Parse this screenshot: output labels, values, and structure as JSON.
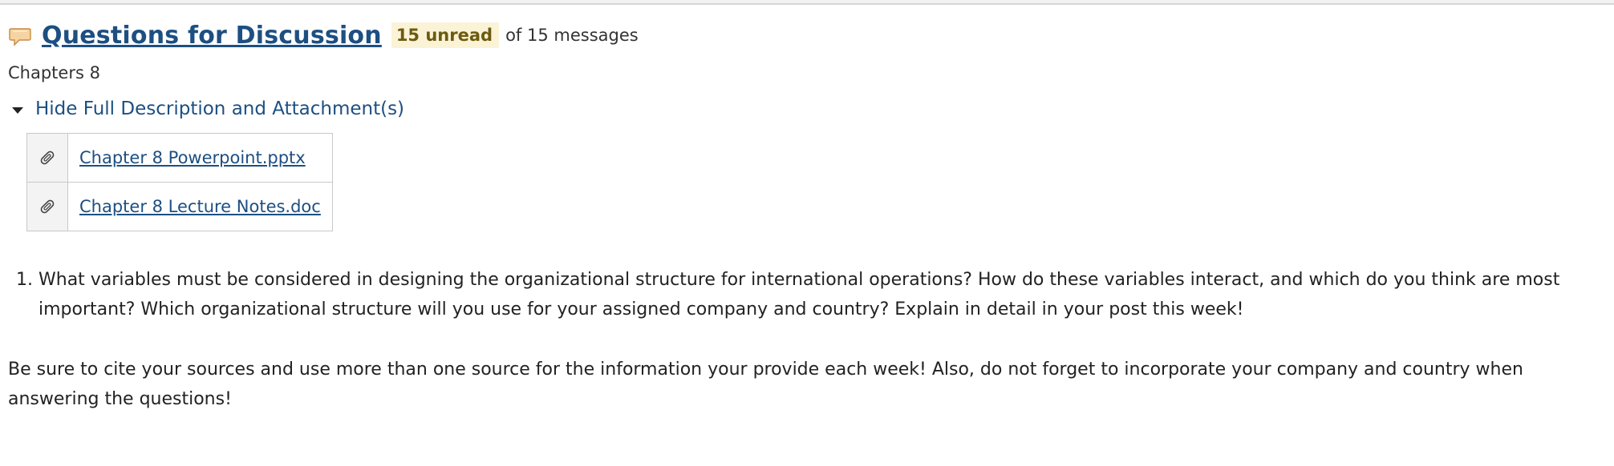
{
  "topic": {
    "title": "Questions for Discussion",
    "unread_badge": "15 unread",
    "message_count": "of 15 messages",
    "subtitle": "Chapters 8"
  },
  "description_toggle": {
    "label": "Hide Full Description and Attachment(s)"
  },
  "attachments": [
    {
      "icon": "paperclip-icon",
      "name": "Chapter 8 Powerpoint.pptx"
    },
    {
      "icon": "paperclip-icon",
      "name": "Chapter 8 Lecture Notes.doc"
    }
  ],
  "questions": [
    "What variables must be considered in designing the organizational structure for international operations? How do these variables interact, and which do you think are most important? Which organizational structure will you use for your assigned company and country? Explain in detail in your post this week!"
  ],
  "note": "Be sure to cite your sources and use more than one source for the information your provide each week! Also, do not forget to incorporate your company and country when answering the questions!",
  "colors": {
    "link": "#1d4f82",
    "unread_badge_bg": "#fbf3d6",
    "unread_badge_text": "#6c5a10",
    "speech_icon": "#f3c68a"
  }
}
